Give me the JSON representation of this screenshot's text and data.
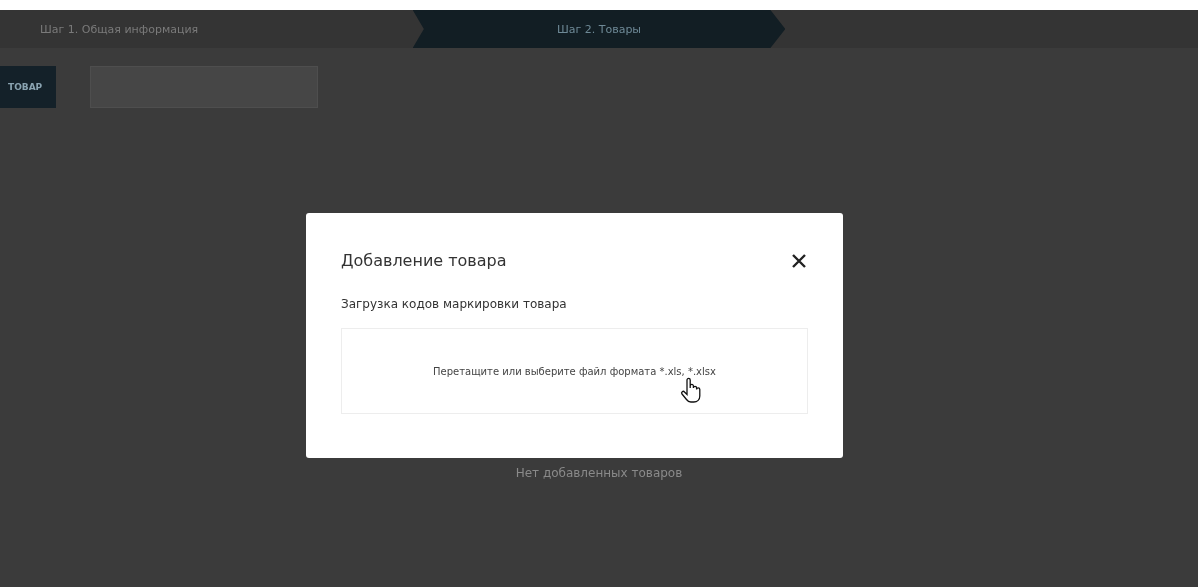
{
  "steps": [
    {
      "label": "Шаг 1. Общая информация",
      "selected": false
    },
    {
      "label": "Шаг 2. Товары",
      "selected": true
    }
  ],
  "toolbar": {
    "add_button": "ТОВАР"
  },
  "empty_message": "Нет добавленных товаров",
  "modal": {
    "title": "Добавление товара",
    "subtitle": "Загрузка кодов маркировки товара",
    "dropzone": "Перетащите или выберите файл формата *.xls, *.xlsx"
  }
}
